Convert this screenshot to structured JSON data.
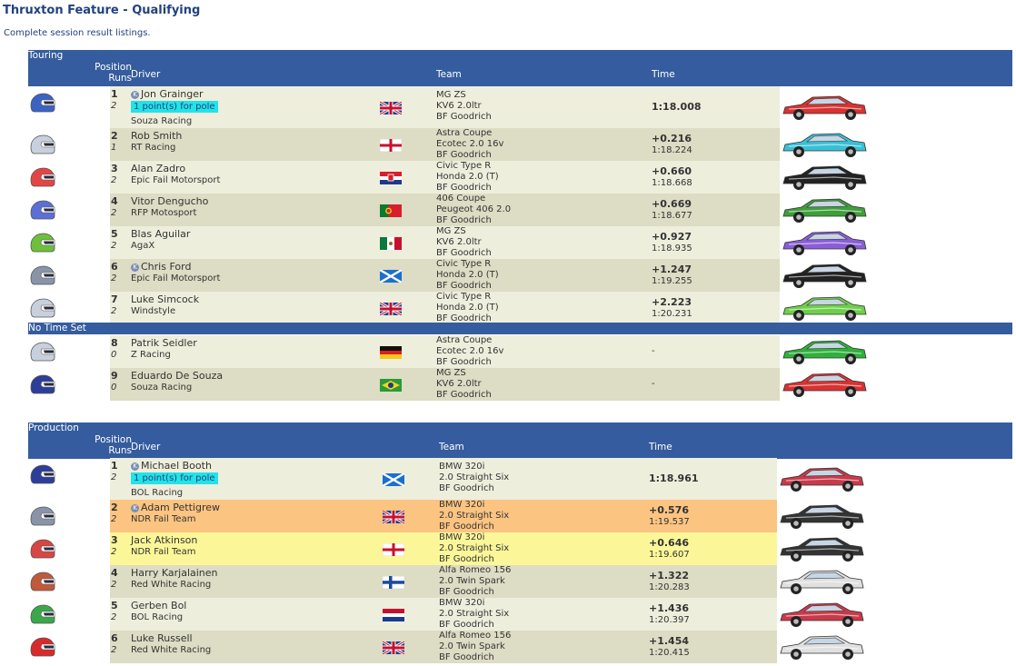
{
  "page": {
    "title": "Thruxton Feature - Qualifying",
    "subtitle": "Complete session result listings."
  },
  "headers": {
    "position": "Position",
    "runs": "Runs",
    "driver": "Driver",
    "team": "Team",
    "time": "Time"
  },
  "pole_text": "1 point(s) for pole",
  "badge_letter": "K",
  "colors": {
    "header_bg": "#355c9e",
    "row_light": "#eeeedd",
    "row_dark": "#dddcc4",
    "highlight_orange": "#fcc481",
    "highlight_yellow": "#fbf799",
    "pole_badge": "#22e3e8",
    "title_text": "#22427e"
  },
  "sections": [
    {
      "name": "Touring",
      "results": [
        {
          "pos": "1",
          "runs": "2",
          "driver": "Jon Grainger",
          "team": "Souza Racing",
          "badge": true,
          "pole": true,
          "flag": "gb",
          "car": [
            "MG ZS",
            "KV6 2.0ltr",
            "BF Goodrich"
          ],
          "time": "1:18.008",
          "lap": "",
          "helmet": "#3b63c4",
          "livery": "#d83232"
        },
        {
          "pos": "2",
          "runs": "1",
          "driver": "Rob Smith",
          "team": "RT Racing",
          "badge": false,
          "pole": false,
          "flag": "england",
          "car": [
            "Astra Coupe",
            "Ecotec 2.0 16v",
            "BF Goodrich"
          ],
          "time": "+0.216",
          "lap": "1:18.224",
          "helmet": "#c7d0dc",
          "livery": "#38c0d6"
        },
        {
          "pos": "3",
          "runs": "2",
          "driver": "Alan Zadro",
          "team": "Epic Fail Motorsport",
          "badge": false,
          "pole": false,
          "flag": "croatia",
          "car": [
            "Civic Type R",
            "Honda 2.0 (T)",
            "BF Goodrich"
          ],
          "time": "+0.660",
          "lap": "1:18.668",
          "helmet": "#e34545",
          "livery": "#222222"
        },
        {
          "pos": "4",
          "runs": "2",
          "driver": "Vitor Dengucho",
          "team": "RFP Motosport",
          "badge": false,
          "pole": false,
          "flag": "portugal",
          "car": [
            "406 Coupe",
            "Peugeot 406 2.0",
            "BF Goodrich"
          ],
          "time": "+0.669",
          "lap": "1:18.677",
          "helmet": "#5a6fd8",
          "livery": "#3f9e3a"
        },
        {
          "pos": "5",
          "runs": "2",
          "driver": "Blas Aguilar",
          "team": "AgaX",
          "badge": false,
          "pole": false,
          "flag": "mexico",
          "car": [
            "MG ZS",
            "KV6 2.0ltr",
            "BF Goodrich"
          ],
          "time": "+0.927",
          "lap": "1:18.935",
          "helmet": "#6cc03a",
          "livery": "#8a5ed8"
        },
        {
          "pos": "6",
          "runs": "2",
          "driver": "Chris Ford",
          "team": "Epic Fail Motorsport",
          "badge": true,
          "pole": false,
          "flag": "scotland",
          "car": [
            "Civic Type R",
            "Honda 2.0 (T)",
            "BF Goodrich"
          ],
          "time": "+1.247",
          "lap": "1:19.255",
          "helmet": "#8894a8",
          "livery": "#222222"
        },
        {
          "pos": "7",
          "runs": "2",
          "driver": "Luke Simcock",
          "team": "Windstyle",
          "badge": false,
          "pole": false,
          "flag": "gb",
          "car": [
            "Civic Type R",
            "Honda 2.0 (T)",
            "BF Goodrich"
          ],
          "time": "+2.223",
          "lap": "1:20.231",
          "helmet": "#c7d0dc",
          "livery": "#6ed04a"
        }
      ],
      "no_time_label": "No Time Set",
      "no_time": [
        {
          "pos": "8",
          "runs": "0",
          "driver": "Patrik Seidler",
          "team": "Z Racing",
          "badge": false,
          "pole": false,
          "flag": "germany",
          "car": [
            "Astra Coupe",
            "Ecotec 2.0 16v",
            "BF Goodrich"
          ],
          "time": "-",
          "lap": "",
          "helmet": "#c7d0dc",
          "livery": "#2fb03a"
        },
        {
          "pos": "9",
          "runs": "0",
          "driver": "Eduardo De Souza",
          "team": "Souza Racing",
          "badge": false,
          "pole": false,
          "flag": "brazil",
          "car": [
            "MG ZS",
            "KV6 2.0ltr",
            "BF Goodrich"
          ],
          "time": "-",
          "lap": "",
          "helmet": "#2c3e9a",
          "livery": "#d83232"
        }
      ]
    },
    {
      "name": "Production",
      "results": [
        {
          "pos": "1",
          "runs": "2",
          "driver": "Michael Booth",
          "team": "BOL Racing",
          "badge": true,
          "pole": true,
          "flag": "scotland",
          "car": [
            "BMW 320i",
            "2.0 Straight Six",
            "BF Goodrich"
          ],
          "time": "1:18.961",
          "lap": "",
          "helmet": "#2c3e9a",
          "livery": "#c83a4a",
          "highlight": ""
        },
        {
          "pos": "2",
          "runs": "2",
          "driver": "Adam Pettigrew",
          "team": "NDR Fail Team",
          "badge": true,
          "pole": false,
          "flag": "gb",
          "car": [
            "BMW 320i",
            "2.0 Straight Six",
            "BF Goodrich"
          ],
          "time": "+0.576",
          "lap": "1:19.537",
          "helmet": "#8894a8",
          "livery": "#333333",
          "highlight": "orange"
        },
        {
          "pos": "3",
          "runs": "2",
          "driver": "Jack Atkinson",
          "team": "NDR Fail Team",
          "badge": false,
          "pole": false,
          "flag": "england",
          "car": [
            "BMW 320i",
            "2.0 Straight Six",
            "BF Goodrich"
          ],
          "time": "+0.646",
          "lap": "1:19.607",
          "helmet": "#d84545",
          "livery": "#333333",
          "highlight": "yellow"
        },
        {
          "pos": "4",
          "runs": "2",
          "driver": "Harry Karjalainen",
          "team": "Red White Racing",
          "badge": false,
          "pole": false,
          "flag": "finland",
          "car": [
            "Alfa Romeo 156",
            "2.0 Twin Spark",
            "BF Goodrich"
          ],
          "time": "+1.322",
          "lap": "1:20.283",
          "helmet": "#c05a3a",
          "livery": "#e0e0e0",
          "highlight": ""
        },
        {
          "pos": "5",
          "runs": "2",
          "driver": "Gerben Bol",
          "team": "BOL Racing",
          "badge": false,
          "pole": false,
          "flag": "netherlands",
          "car": [
            "BMW 320i",
            "2.0 Straight Six",
            "BF Goodrich"
          ],
          "time": "+1.436",
          "lap": "1:20.397",
          "helmet": "#3aa84a",
          "livery": "#c83a4a",
          "highlight": ""
        },
        {
          "pos": "6",
          "runs": "2",
          "driver": "Luke Russell",
          "team": "Red White Racing",
          "badge": false,
          "pole": false,
          "flag": "gb",
          "car": [
            "Alfa Romeo 156",
            "2.0 Twin Spark",
            "BF Goodrich"
          ],
          "time": "+1.454",
          "lap": "1:20.415",
          "helmet": "#d82a2a",
          "livery": "#e0e0e0",
          "highlight": ""
        }
      ]
    }
  ]
}
